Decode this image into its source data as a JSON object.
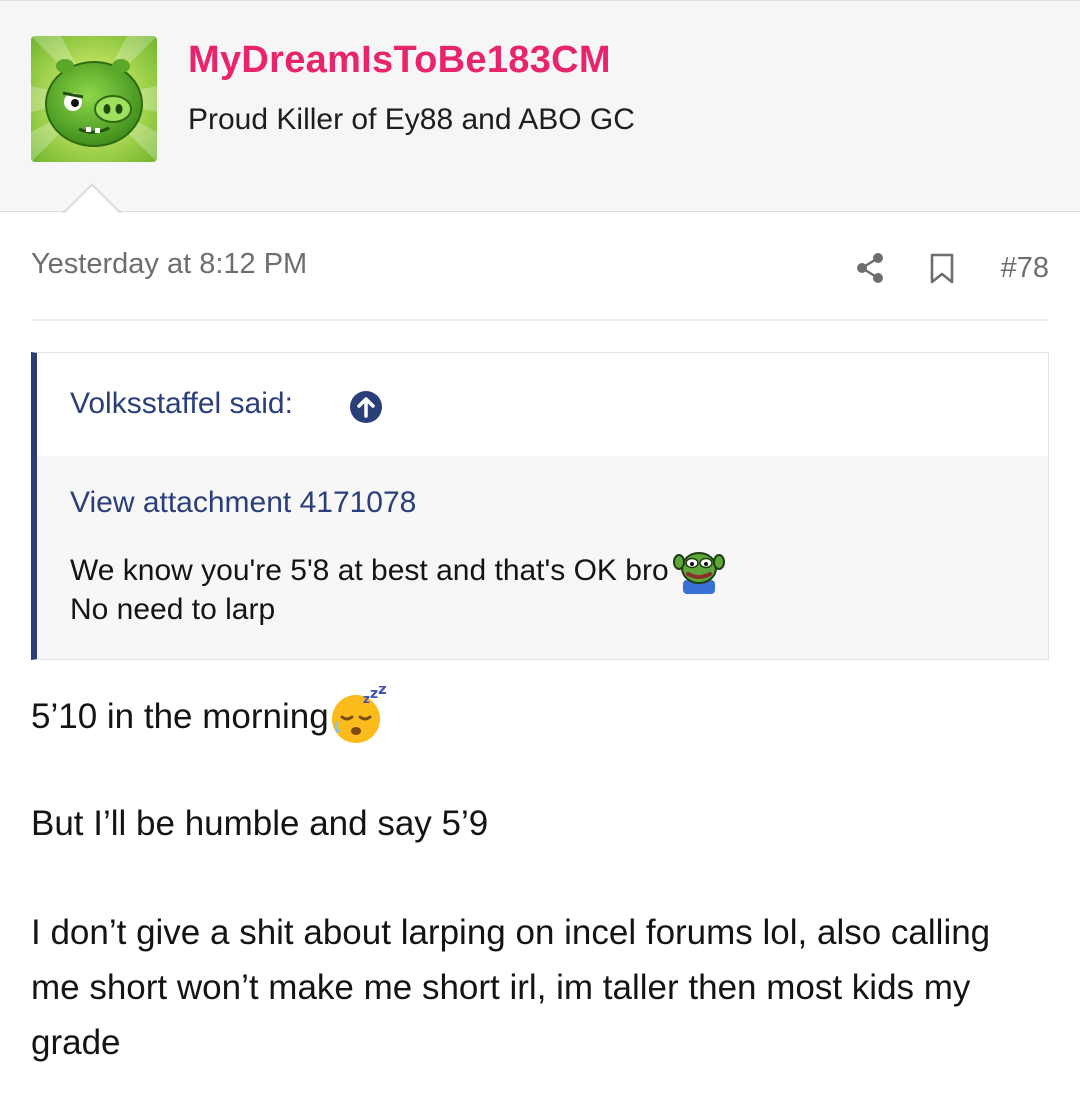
{
  "user": {
    "name": "MyDreamIsToBe183CM",
    "title": "Proud Killer of Ey88 and ABO GC",
    "avatar_icon": "green-pig-avatar-icon"
  },
  "post": {
    "date": "Yesterday at 8:12 PM",
    "number": "#78",
    "share_icon": "share-icon",
    "bookmark_icon": "bookmark-icon"
  },
  "quote": {
    "author": "Volksstaffel said:",
    "jump_icon": "arrow-up-circle-icon",
    "attachment": "View attachment 4171078",
    "line1": "We know you're 5'8 at best and that's OK bro",
    "line2": "No need to larp",
    "emoji": "pepe-emoji"
  },
  "body": {
    "line1": "5’10 in the morning",
    "line1_emoji": "sleeping-face-emoji",
    "line2": "But I’ll be humble and say 5’9",
    "line3": "I don’t give a shit about larping on incel forums lol, also calling me short won’t make me short irl, im taller then most kids my grade"
  },
  "colors": {
    "username": "#e8246c",
    "link": "#2a3f7a",
    "quote_bar": "#2c3e72",
    "meta": "#6e6e6e"
  }
}
